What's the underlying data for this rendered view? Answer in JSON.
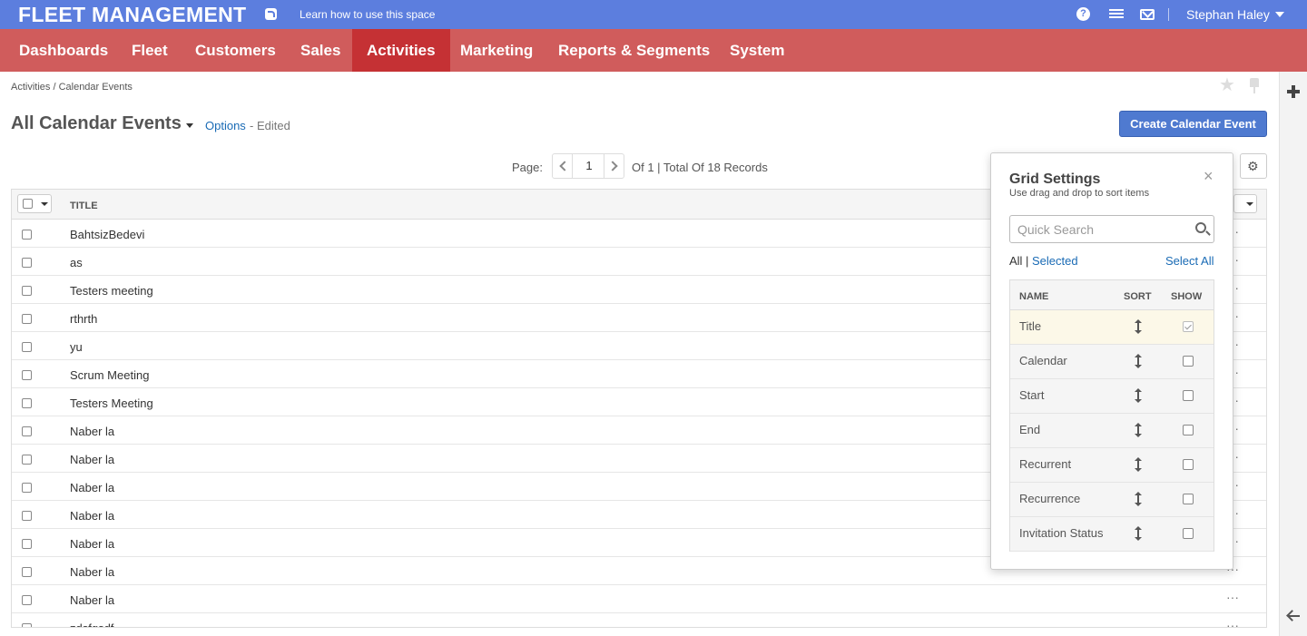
{
  "topbar": {
    "brand": "FLEET MANAGEMENT",
    "learn_link": "Learn how to use this space",
    "help_icon": "help-icon",
    "help_glyph": "?",
    "user_name": "Stephan Haley",
    "color": "#5c7ede"
  },
  "nav": {
    "items": [
      "Dashboards",
      "Fleet",
      "Customers",
      "Sales",
      "Activities",
      "Marketing",
      "Reports & Segments",
      "System"
    ],
    "active": "Activities",
    "color": "#d05c5c",
    "active_color": "#c53134"
  },
  "breadcrumb": "Activities / Calendar Events",
  "page": {
    "title": "All Calendar Events",
    "options_label": "Options",
    "edited_label": "- Edited",
    "create_button": "Create Calendar Event"
  },
  "pager": {
    "label": "Page:",
    "current": "1",
    "info": "Of 1 | Total Of 18 Records"
  },
  "grid": {
    "column_title": "TITLE",
    "rows": [
      "BahtsizBedevi",
      "as",
      "Testers meeting",
      "rthrth",
      "yu",
      "Scrum Meeting",
      "Testers Meeting",
      "Naber la",
      "Naber la",
      "Naber la",
      "Naber la",
      "Naber la",
      "Naber la",
      "Naber la",
      "zdsfgsdf"
    ],
    "row_action": "···"
  },
  "grid_settings": {
    "title": "Grid Settings",
    "subtitle": "Use drag and drop to sort items",
    "close": "×",
    "search_placeholder": "Quick Search",
    "filter_all": "All |",
    "filter_selected": "Selected",
    "select_all": "Select All",
    "headers": {
      "name": "NAME",
      "sort": "SORT",
      "show": "SHOW"
    },
    "columns": [
      {
        "name": "Title",
        "show": true
      },
      {
        "name": "Calendar",
        "show": false
      },
      {
        "name": "Start",
        "show": false
      },
      {
        "name": "End",
        "show": false
      },
      {
        "name": "Recurrent",
        "show": false
      },
      {
        "name": "Recurrence",
        "show": false
      },
      {
        "name": "Invitation Status",
        "show": false
      }
    ]
  }
}
